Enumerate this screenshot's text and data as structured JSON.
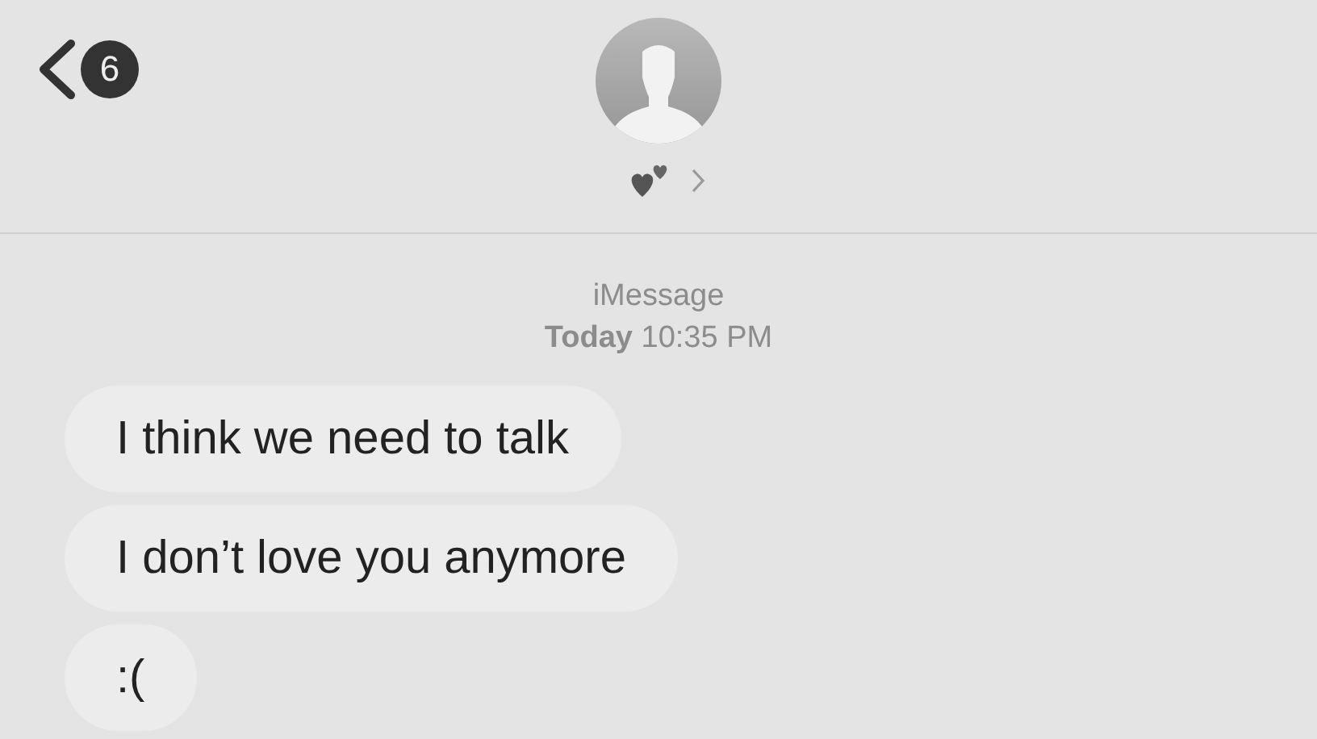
{
  "header": {
    "back_badge": "6"
  },
  "thread": {
    "service": "iMessage",
    "timestamp": "**Today** 10:35 PM"
  },
  "messages": [
    {
      "text": "I think we need to talk"
    },
    {
      "text": "I don’t love you anymore"
    },
    {
      "text": ":("
    }
  ]
}
